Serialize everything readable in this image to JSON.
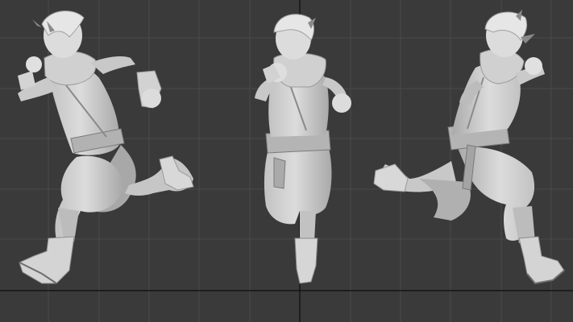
{
  "viewport": {
    "background": "#3a3a3a",
    "grid_color": "#4a4a4a",
    "axis_color": "#141414",
    "model_color": "#d4d4d4",
    "model_shadow_color": "#9a9a9a",
    "model_dark_color": "#6e6e6e"
  },
  "models": [
    {
      "view": "left"
    },
    {
      "view": "front"
    },
    {
      "view": "right"
    }
  ]
}
